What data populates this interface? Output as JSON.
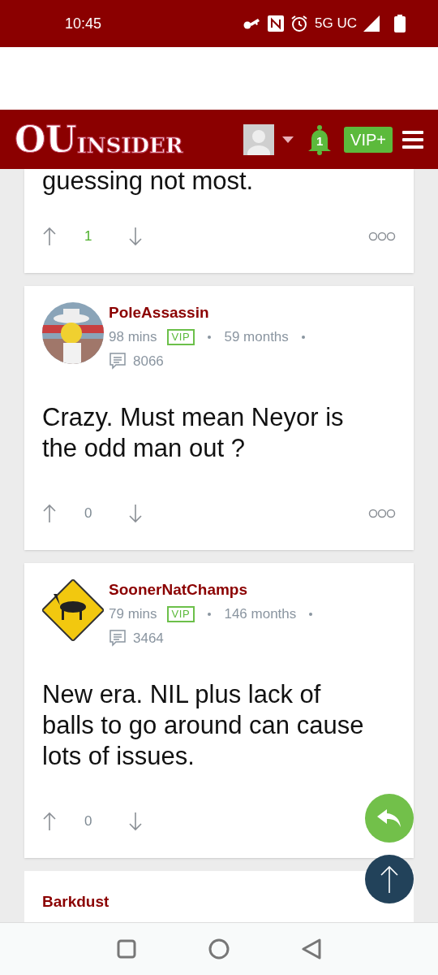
{
  "status_bar": {
    "time": "10:45",
    "network": "5G UC"
  },
  "header": {
    "logo_big": "OU",
    "logo_small": "INSIDER",
    "notifications": "1",
    "vip": "VIP+"
  },
  "posts": [
    {
      "partial": true,
      "body": "guessing not most.",
      "votes": "1",
      "upvoted": true
    },
    {
      "partial": false,
      "author": "PoleAssassin",
      "time": "98 mins",
      "badge": "VIP",
      "tenure": "59 months",
      "post_count": "8066",
      "body": "Crazy. Must mean Neyor is the odd man out ?",
      "votes": "0",
      "upvoted": false
    },
    {
      "partial": false,
      "author": "SoonerNatChamps",
      "time": "79 mins",
      "badge": "VIP",
      "tenure": "146 months",
      "post_count": "3464",
      "body": "New era. NIL plus lack of balls to go around can cause lots of issues.",
      "votes": "0",
      "upvoted": false
    }
  ],
  "next_author": "Barkdust"
}
